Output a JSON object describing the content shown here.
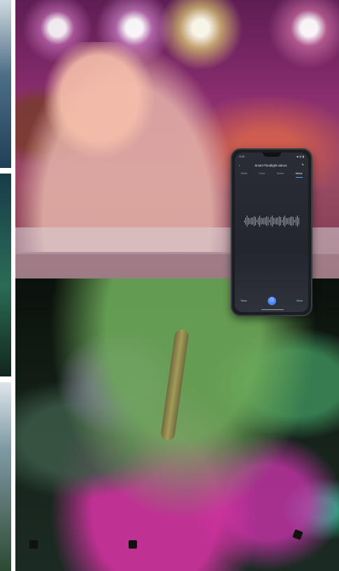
{
  "phone": {
    "time": "3:26",
    "battery": "■ ◍ ▮",
    "title": "Smart Floodlight-videos",
    "tabs": [
      "White",
      "Color",
      "Scene",
      "Music"
    ],
    "active_tab": "Music",
    "bottom": {
      "left": "Timer",
      "right": "More"
    },
    "icons": [
      "back-icon",
      "edit-icon",
      "power-icon"
    ]
  }
}
